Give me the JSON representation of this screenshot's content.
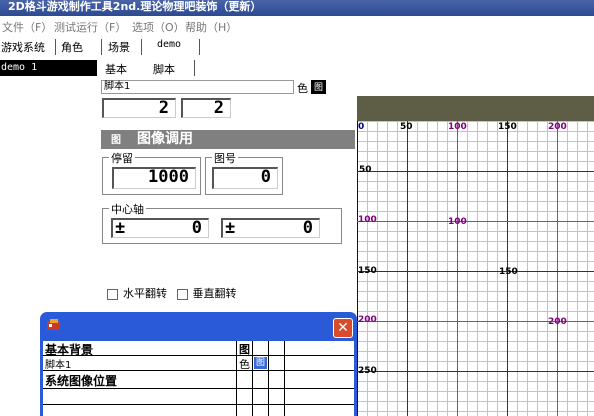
{
  "window": {
    "title": "2D格斗游戏制作工具2nd.理论物理吧装饰（更新）"
  },
  "menu": [
    {
      "label": "文件（F）"
    },
    {
      "label": "测试运行（F）"
    },
    {
      "label": "选项（O）"
    },
    {
      "label": "帮助（H）"
    }
  ],
  "top_tabs": [
    {
      "label": "游戏系统"
    },
    {
      "label": "角色"
    },
    {
      "label": "场景"
    },
    {
      "label": "demo"
    }
  ],
  "list": {
    "selected": "demo 1"
  },
  "sub_tabs": [
    {
      "label": "基本"
    },
    {
      "label": "脚本"
    }
  ],
  "script": {
    "name": "脚本1",
    "color_label": "色",
    "image_btn": "图"
  },
  "counters": {
    "left": "2",
    "right": "2"
  },
  "image_call": {
    "icon": "图",
    "title": "图像调用",
    "hold_label": "停留",
    "hold_value": "1000",
    "image_no_label": "图号",
    "image_no_value": "0",
    "axis_label": "中心轴",
    "axis_x_sign": "±",
    "axis_x_value": "0",
    "axis_y_sign": "±",
    "axis_y_value": "0",
    "flip_h": "水平翻转",
    "flip_v": "垂直翻转"
  },
  "canvas": {
    "x_labels": [
      {
        "text": "0",
        "color": "#000080"
      },
      {
        "text": "50",
        "color": "#000000"
      },
      {
        "text": "100",
        "color": "#800080"
      },
      {
        "text": "150",
        "color": "#000000"
      },
      {
        "text": "200",
        "color": "#800080"
      }
    ],
    "y_labels": [
      {
        "text": "50",
        "color": "#000000"
      },
      {
        "text": "100",
        "color": "#800080"
      },
      {
        "text": "150",
        "color": "#000000"
      },
      {
        "text": "200",
        "color": "#800080"
      },
      {
        "text": "250",
        "color": "#000000"
      }
    ],
    "inner_labels": [
      {
        "text": "100",
        "color": "#800080"
      },
      {
        "text": "150",
        "color": "#000000"
      },
      {
        "text": "200",
        "color": "#800080"
      }
    ]
  },
  "popup": {
    "rows": [
      {
        "label": "基本背景",
        "tail": "图"
      },
      {
        "label": "脚本1",
        "tail": "色",
        "tail2": "图"
      },
      {
        "label": "系统图像位置",
        "tail": ""
      },
      {
        "label": "",
        "tail": ""
      }
    ]
  }
}
